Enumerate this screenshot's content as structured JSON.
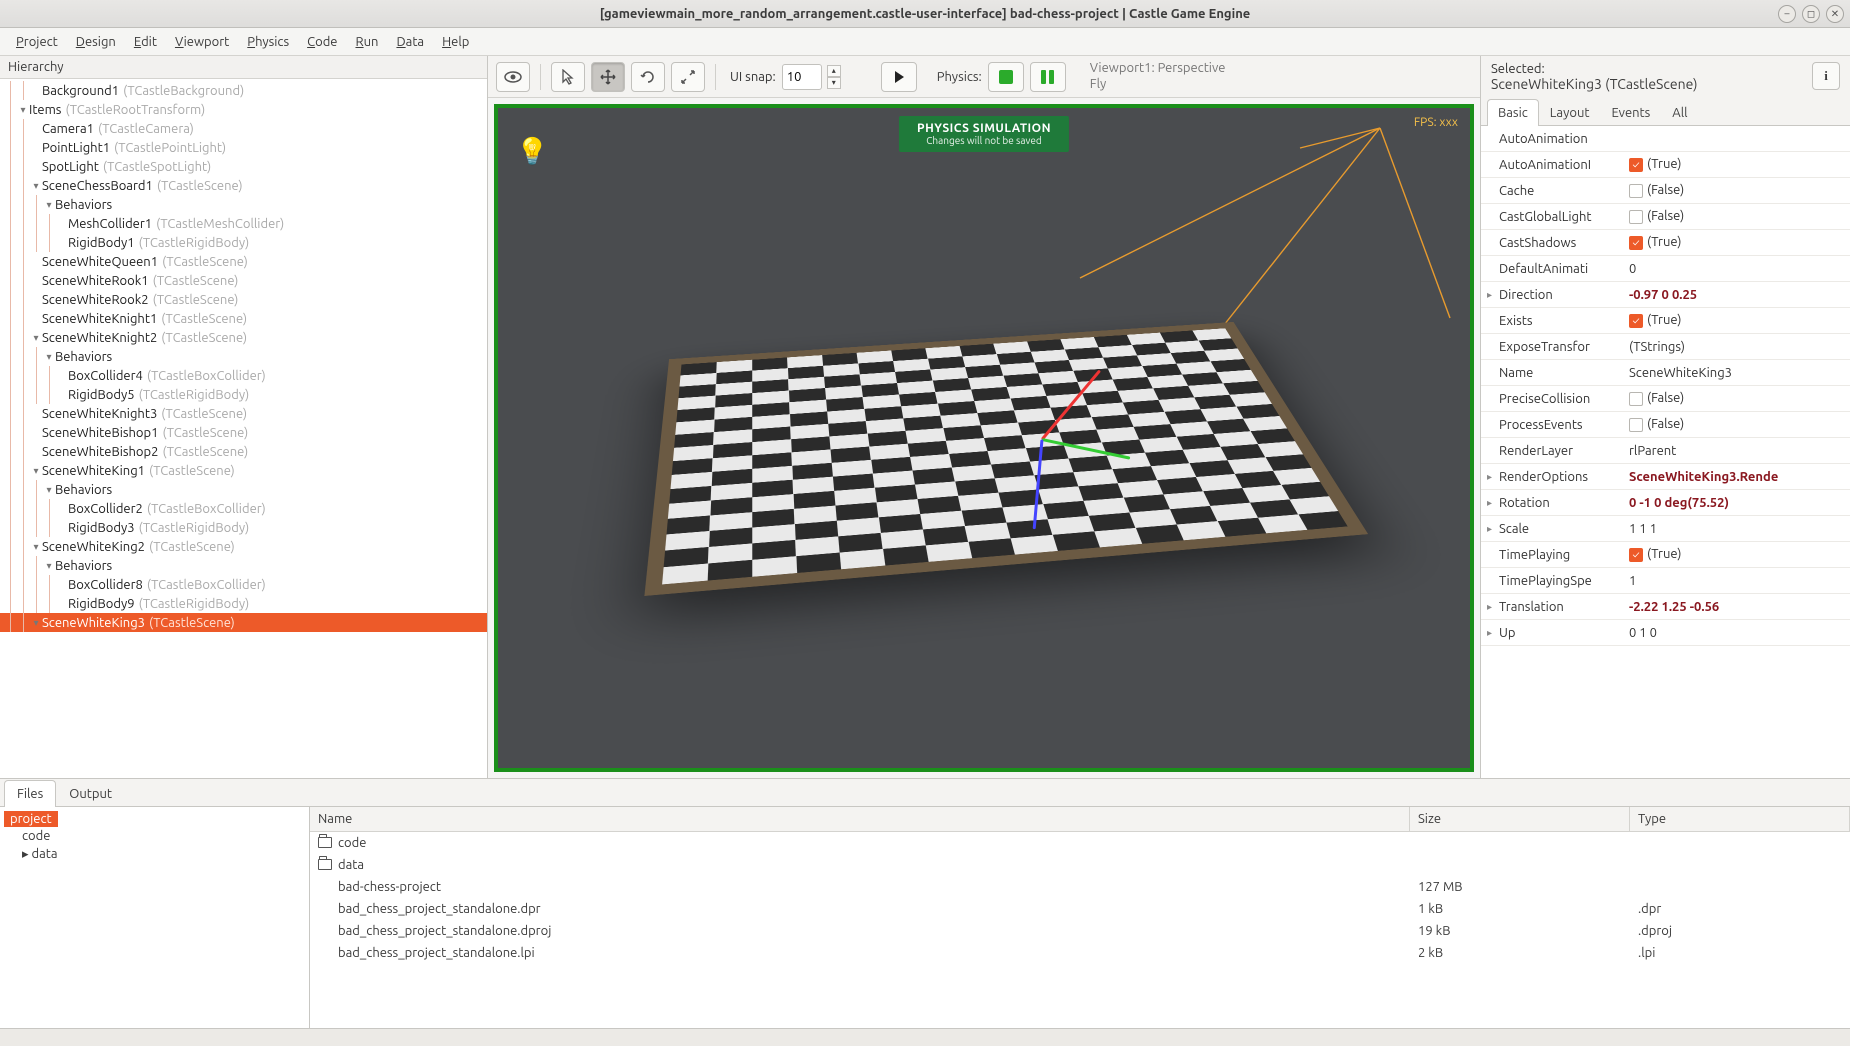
{
  "window": {
    "title": "[gameviewmain_more_random_arrangement.castle-user-interface] bad-chess-project | Castle Game Engine"
  },
  "menu": [
    "Project",
    "Design",
    "Edit",
    "Viewport",
    "Physics",
    "Code",
    "Run",
    "Data",
    "Help"
  ],
  "hierarchy": {
    "header": "Hierarchy",
    "items": [
      {
        "depth": 2,
        "exp": "",
        "name": "Background1",
        "cls": "(TCastleBackground)"
      },
      {
        "depth": 1,
        "exp": "▾",
        "name": "Items",
        "cls": "(TCastleRootTransform)"
      },
      {
        "depth": 2,
        "exp": "",
        "name": "Camera1",
        "cls": "(TCastleCamera)"
      },
      {
        "depth": 2,
        "exp": "",
        "name": "PointLight1",
        "cls": "(TCastlePointLight)"
      },
      {
        "depth": 2,
        "exp": "",
        "name": "SpotLight",
        "cls": "(TCastleSpotLight)"
      },
      {
        "depth": 2,
        "exp": "▾",
        "name": "SceneChessBoard1",
        "cls": "(TCastleScene)"
      },
      {
        "depth": 3,
        "exp": "▾",
        "name": "Behaviors",
        "cls": ""
      },
      {
        "depth": 4,
        "exp": "",
        "name": "MeshCollider1",
        "cls": "(TCastleMeshCollider)"
      },
      {
        "depth": 4,
        "exp": "",
        "name": "RigidBody1",
        "cls": "(TCastleRigidBody)"
      },
      {
        "depth": 2,
        "exp": "",
        "name": "SceneWhiteQueen1",
        "cls": "(TCastleScene)"
      },
      {
        "depth": 2,
        "exp": "",
        "name": "SceneWhiteRook1",
        "cls": "(TCastleScene)"
      },
      {
        "depth": 2,
        "exp": "",
        "name": "SceneWhiteRook2",
        "cls": "(TCastleScene)"
      },
      {
        "depth": 2,
        "exp": "",
        "name": "SceneWhiteKnight1",
        "cls": "(TCastleScene)"
      },
      {
        "depth": 2,
        "exp": "▾",
        "name": "SceneWhiteKnight2",
        "cls": "(TCastleScene)"
      },
      {
        "depth": 3,
        "exp": "▾",
        "name": "Behaviors",
        "cls": ""
      },
      {
        "depth": 4,
        "exp": "",
        "name": "BoxCollider4",
        "cls": "(TCastleBoxCollider)"
      },
      {
        "depth": 4,
        "exp": "",
        "name": "RigidBody5",
        "cls": "(TCastleRigidBody)"
      },
      {
        "depth": 2,
        "exp": "",
        "name": "SceneWhiteKnight3",
        "cls": "(TCastleScene)"
      },
      {
        "depth": 2,
        "exp": "",
        "name": "SceneWhiteBishop1",
        "cls": "(TCastleScene)"
      },
      {
        "depth": 2,
        "exp": "",
        "name": "SceneWhiteBishop2",
        "cls": "(TCastleScene)"
      },
      {
        "depth": 2,
        "exp": "▾",
        "name": "SceneWhiteKing1",
        "cls": "(TCastleScene)"
      },
      {
        "depth": 3,
        "exp": "▾",
        "name": "Behaviors",
        "cls": ""
      },
      {
        "depth": 4,
        "exp": "",
        "name": "BoxCollider2",
        "cls": "(TCastleBoxCollider)"
      },
      {
        "depth": 4,
        "exp": "",
        "name": "RigidBody3",
        "cls": "(TCastleRigidBody)"
      },
      {
        "depth": 2,
        "exp": "▾",
        "name": "SceneWhiteKing2",
        "cls": "(TCastleScene)"
      },
      {
        "depth": 3,
        "exp": "▾",
        "name": "Behaviors",
        "cls": ""
      },
      {
        "depth": 4,
        "exp": "",
        "name": "BoxCollider8",
        "cls": "(TCastleBoxCollider)"
      },
      {
        "depth": 4,
        "exp": "",
        "name": "RigidBody9",
        "cls": "(TCastleRigidBody)"
      },
      {
        "depth": 2,
        "exp": "▾",
        "name": "SceneWhiteKing3",
        "cls": "(TCastleScene)",
        "selected": true
      }
    ]
  },
  "toolbar": {
    "uisnap_label": "UI snap:",
    "uisnap_value": "10",
    "physics_label": "Physics:",
    "vpinfo_l1": "Viewport1: Perspective",
    "vpinfo_l2": "Fly"
  },
  "viewport": {
    "banner_title": "PHYSICS SIMULATION",
    "banner_sub": "Changes will not be saved",
    "fps": "FPS: xxx"
  },
  "inspector": {
    "selected_label": "Selected:",
    "selected_value": "SceneWhiteKing3 (TCastleScene)",
    "tabs": [
      "Basic",
      "Layout",
      "Events",
      "All"
    ],
    "props": [
      {
        "exp": "",
        "k": "AutoAnimation",
        "v": "",
        "bold": false,
        "chk": null
      },
      {
        "exp": "",
        "k": "AutoAnimationI",
        "v": "(True)",
        "bold": false,
        "chk": true
      },
      {
        "exp": "",
        "k": "Cache",
        "v": "(False)",
        "bold": false,
        "chk": false
      },
      {
        "exp": "",
        "k": "CastGlobalLight",
        "v": "(False)",
        "bold": false,
        "chk": false
      },
      {
        "exp": "",
        "k": "CastShadows",
        "v": "(True)",
        "bold": false,
        "chk": true
      },
      {
        "exp": "",
        "k": "DefaultAnimati",
        "v": "0",
        "bold": false,
        "chk": null
      },
      {
        "exp": "▸",
        "k": "Direction",
        "v": "-0.97 0 0.25",
        "bold": true,
        "chk": null
      },
      {
        "exp": "",
        "k": "Exists",
        "v": "(True)",
        "bold": false,
        "chk": true
      },
      {
        "exp": "",
        "k": "ExposeTransfor",
        "v": "(TStrings)",
        "bold": false,
        "chk": null
      },
      {
        "exp": "",
        "k": "Name",
        "v": "SceneWhiteKing3",
        "bold": false,
        "chk": null
      },
      {
        "exp": "",
        "k": "PreciseCollision",
        "v": "(False)",
        "bold": false,
        "chk": false
      },
      {
        "exp": "",
        "k": "ProcessEvents",
        "v": "(False)",
        "bold": false,
        "chk": false
      },
      {
        "exp": "",
        "k": "RenderLayer",
        "v": "rlParent",
        "bold": false,
        "chk": null
      },
      {
        "exp": "▸",
        "k": "RenderOptions",
        "v": "SceneWhiteKing3.Rende",
        "bold": true,
        "chk": null
      },
      {
        "exp": "▸",
        "k": "Rotation",
        "v": "0 -1 0 deg(75.52)",
        "bold": true,
        "chk": null
      },
      {
        "exp": "▸",
        "k": "Scale",
        "v": "1 1 1",
        "bold": false,
        "chk": null
      },
      {
        "exp": "",
        "k": "TimePlaying",
        "v": "(True)",
        "bold": false,
        "chk": true
      },
      {
        "exp": "",
        "k": "TimePlayingSpe",
        "v": "1",
        "bold": false,
        "chk": null
      },
      {
        "exp": "▸",
        "k": "Translation",
        "v": "-2.22 1.25 -0.56",
        "bold": true,
        "chk": null
      },
      {
        "exp": "▸",
        "k": "Up",
        "v": "0 1 0",
        "bold": false,
        "chk": null
      }
    ]
  },
  "bottom": {
    "tabs": [
      "Files",
      "Output"
    ],
    "tree": [
      {
        "label": "project",
        "sel": true,
        "depth": 0
      },
      {
        "label": "code",
        "sel": false,
        "depth": 1
      },
      {
        "label": "data",
        "sel": false,
        "depth": 1,
        "exp": "▸"
      }
    ],
    "cols": {
      "name": "Name",
      "size": "Size",
      "type": "Type"
    },
    "rows": [
      {
        "icon": "folder",
        "name": "code",
        "size": "",
        "type": ""
      },
      {
        "icon": "folder",
        "name": "data",
        "size": "",
        "type": ""
      },
      {
        "icon": "",
        "name": "bad-chess-project",
        "size": "127 MB",
        "type": ""
      },
      {
        "icon": "",
        "name": "bad_chess_project_standalone.dpr",
        "size": "1 kB",
        "type": ".dpr"
      },
      {
        "icon": "",
        "name": "bad_chess_project_standalone.dproj",
        "size": "19 kB",
        "type": ".dproj"
      },
      {
        "icon": "",
        "name": "bad_chess_project_standalone.lpi",
        "size": "2 kB",
        "type": ".lpi"
      }
    ]
  }
}
